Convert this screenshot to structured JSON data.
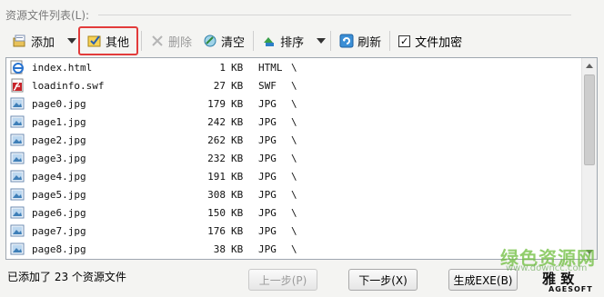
{
  "group_label": "资源文件列表(L):",
  "toolbar": {
    "add_label": "添加",
    "other_label": "其他",
    "delete_label": "删除",
    "clear_label": "清空",
    "sort_label": "排序",
    "refresh_label": "刷新",
    "encrypt_label": "文件加密",
    "encrypt_checked": "✓",
    "highlight_color": "#e23b3b"
  },
  "files": [
    {
      "icon": "ie-html-icon",
      "name": "index.html",
      "size": "1",
      "unit": "KB",
      "type": "HTML",
      "path": "\\"
    },
    {
      "icon": "flash-swf-icon",
      "name": "loadinfo.swf",
      "size": "27",
      "unit": "KB",
      "type": "SWF",
      "path": "\\"
    },
    {
      "icon": "image-file-icon",
      "name": "page0.jpg",
      "size": "179",
      "unit": "KB",
      "type": "JPG",
      "path": "\\"
    },
    {
      "icon": "image-file-icon",
      "name": "page1.jpg",
      "size": "242",
      "unit": "KB",
      "type": "JPG",
      "path": "\\"
    },
    {
      "icon": "image-file-icon",
      "name": "page2.jpg",
      "size": "262",
      "unit": "KB",
      "type": "JPG",
      "path": "\\"
    },
    {
      "icon": "image-file-icon",
      "name": "page3.jpg",
      "size": "232",
      "unit": "KB",
      "type": "JPG",
      "path": "\\"
    },
    {
      "icon": "image-file-icon",
      "name": "page4.jpg",
      "size": "191",
      "unit": "KB",
      "type": "JPG",
      "path": "\\"
    },
    {
      "icon": "image-file-icon",
      "name": "page5.jpg",
      "size": "308",
      "unit": "KB",
      "type": "JPG",
      "path": "\\"
    },
    {
      "icon": "image-file-icon",
      "name": "page6.jpg",
      "size": "150",
      "unit": "KB",
      "type": "JPG",
      "path": "\\"
    },
    {
      "icon": "image-file-icon",
      "name": "page7.jpg",
      "size": "176",
      "unit": "KB",
      "type": "JPG",
      "path": "\\"
    },
    {
      "icon": "image-file-icon",
      "name": "page8.jpg",
      "size": "38",
      "unit": "KB",
      "type": "JPG",
      "path": "\\"
    }
  ],
  "status_text": "已添加了 23 个资源文件",
  "buttons": {
    "prev": "上一步(P)",
    "next": "下一步(X)",
    "build": "生成EXE(B)"
  },
  "watermark": {
    "cn": "绿色资源网",
    "url": "www.downcc.com",
    "logo": "雅 致",
    "sub": "AGESOFT"
  }
}
